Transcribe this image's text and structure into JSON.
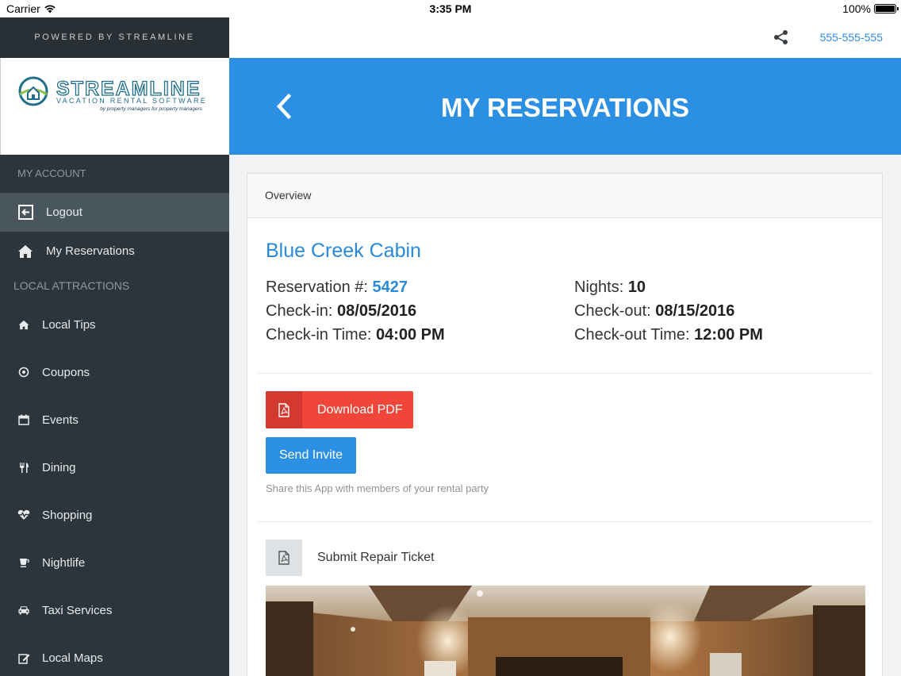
{
  "status_bar": {
    "carrier": "Carrier",
    "time": "3:35 PM",
    "battery": "100%"
  },
  "sidebar": {
    "powered_by": "POWERED BY STREAMLINE",
    "logo": {
      "name": "STREAMLINE",
      "subtitle": "VACATION RENTAL SOFTWARE",
      "tagline": "by property managers for property managers"
    },
    "account_section": "MY ACCOUNT",
    "account_items": [
      {
        "label": "Logout",
        "icon": "logout-icon",
        "active": true
      },
      {
        "label": "My Reservations",
        "icon": "home-icon",
        "active": false
      }
    ],
    "attractions_section": "LOCAL ATTRACTIONS",
    "attractions": [
      {
        "label": "Local Tips",
        "icon": "home-icon"
      },
      {
        "label": "Coupons",
        "icon": "target-icon"
      },
      {
        "label": "Events",
        "icon": "calendar-icon"
      },
      {
        "label": "Dining",
        "icon": "utensils-icon"
      },
      {
        "label": "Shopping",
        "icon": "heartbeat-icon"
      },
      {
        "label": "Nightlife",
        "icon": "glass-icon"
      },
      {
        "label": "Taxi Services",
        "icon": "car-icon"
      },
      {
        "label": "Local Maps",
        "icon": "edit-icon"
      }
    ]
  },
  "topbar": {
    "phone": "555-555-555",
    "share_icon": "share-icon"
  },
  "header": {
    "title": "MY RESERVATIONS",
    "back_icon": "chevron-left-icon"
  },
  "card": {
    "tab": "Overview",
    "property_name": "Blue Creek Cabin",
    "reservation_label": "Reservation #: ",
    "reservation_number": "5427",
    "checkin_label": "Check-in: ",
    "checkin_date": "08/05/2016",
    "checkin_time_label": "Check-in Time: ",
    "checkin_time": "04:00 PM",
    "nights_label": "Nights: ",
    "nights": "10",
    "checkout_label": "Check-out: ",
    "checkout_date": "08/15/2016",
    "checkout_time_label": "Check-out Time: ",
    "checkout_time": "12:00 PM",
    "download_pdf": "Download PDF",
    "send_invite": "Send Invite",
    "invite_help": "Share this App with members of your rental party",
    "repair_ticket": "Submit Repair Ticket"
  },
  "colors": {
    "accent_blue": "#2b8fe3",
    "sidebar_bg": "#2c353b",
    "pdf_red": "#f0463a"
  }
}
